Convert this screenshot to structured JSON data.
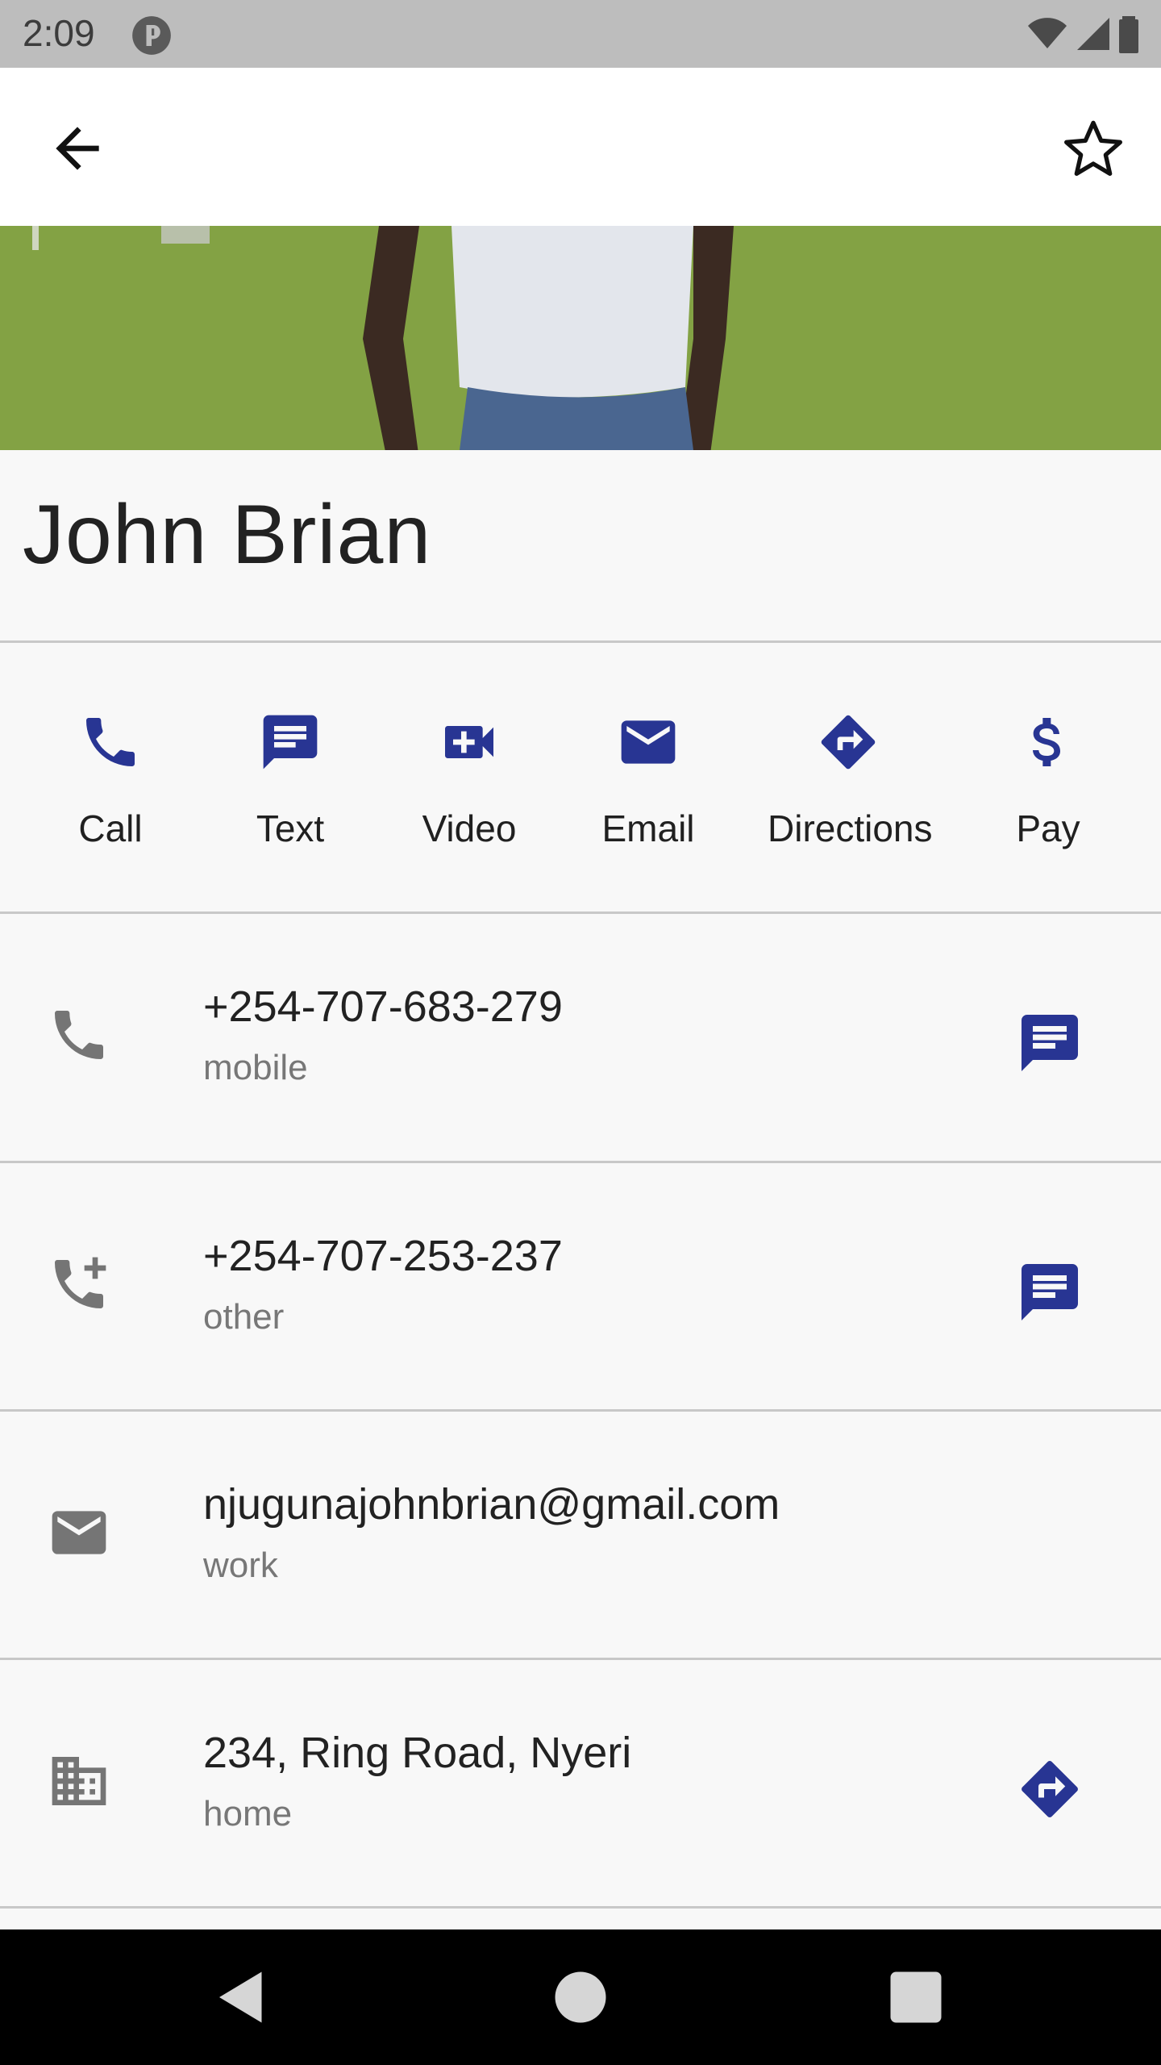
{
  "status_bar": {
    "time": "2:09",
    "icons": [
      "app-notification-icon",
      "wifi-icon",
      "signal-icon",
      "battery-icon"
    ]
  },
  "app_bar": {
    "back_icon": "arrow-back-icon",
    "favorite_icon": "star-outline-icon"
  },
  "contact": {
    "name": "John Brian"
  },
  "actions": [
    {
      "label": "Call",
      "icon": "phone-icon"
    },
    {
      "label": "Text",
      "icon": "message-icon"
    },
    {
      "label": "Video",
      "icon": "video-icon"
    },
    {
      "label": "Email",
      "icon": "email-icon"
    },
    {
      "label": "Directions",
      "icon": "directions-icon"
    },
    {
      "label": "Pay",
      "icon": "dollar-icon"
    }
  ],
  "details": [
    {
      "value": "+254-707-683-279",
      "type": "mobile",
      "icon": "phone-icon",
      "action_icon": "message-icon"
    },
    {
      "value": "+254-707-253-237",
      "type": "other",
      "icon": "phone-add-icon",
      "action_icon": "message-icon"
    },
    {
      "value": "njugunajohnbrian@gmail.com",
      "type": "work",
      "icon": "email-icon"
    },
    {
      "value": "234, Ring Road, Nyeri",
      "type": "home",
      "icon": "building-icon",
      "action_icon": "directions-icon"
    }
  ],
  "nav_bar": {
    "buttons": [
      "back-triangle-icon",
      "home-circle-icon",
      "recents-square-icon"
    ]
  },
  "colors": {
    "accent": "#283593",
    "icon_gray": "#757575",
    "status_bar": "#bdbdbd"
  }
}
